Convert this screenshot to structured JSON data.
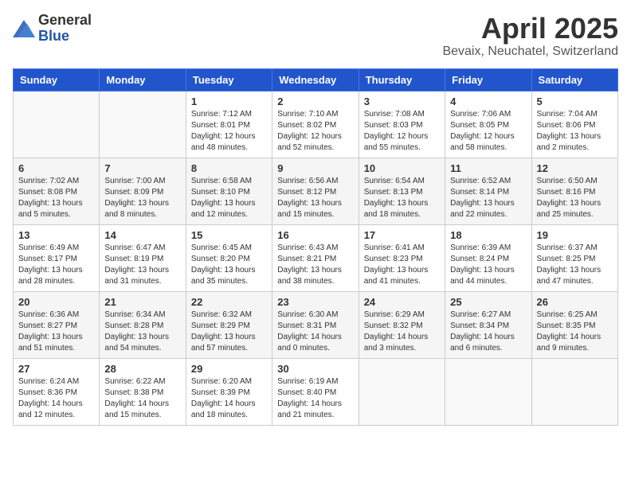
{
  "header": {
    "logo_general": "General",
    "logo_blue": "Blue",
    "month_title": "April 2025",
    "location": "Bevaix, Neuchatel, Switzerland"
  },
  "weekdays": [
    "Sunday",
    "Monday",
    "Tuesday",
    "Wednesday",
    "Thursday",
    "Friday",
    "Saturday"
  ],
  "weeks": [
    [
      {
        "day": "",
        "sunrise": "",
        "sunset": "",
        "daylight": ""
      },
      {
        "day": "",
        "sunrise": "",
        "sunset": "",
        "daylight": ""
      },
      {
        "day": "1",
        "sunrise": "Sunrise: 7:12 AM",
        "sunset": "Sunset: 8:01 PM",
        "daylight": "Daylight: 12 hours and 48 minutes."
      },
      {
        "day": "2",
        "sunrise": "Sunrise: 7:10 AM",
        "sunset": "Sunset: 8:02 PM",
        "daylight": "Daylight: 12 hours and 52 minutes."
      },
      {
        "day": "3",
        "sunrise": "Sunrise: 7:08 AM",
        "sunset": "Sunset: 8:03 PM",
        "daylight": "Daylight: 12 hours and 55 minutes."
      },
      {
        "day": "4",
        "sunrise": "Sunrise: 7:06 AM",
        "sunset": "Sunset: 8:05 PM",
        "daylight": "Daylight: 12 hours and 58 minutes."
      },
      {
        "day": "5",
        "sunrise": "Sunrise: 7:04 AM",
        "sunset": "Sunset: 8:06 PM",
        "daylight": "Daylight: 13 hours and 2 minutes."
      }
    ],
    [
      {
        "day": "6",
        "sunrise": "Sunrise: 7:02 AM",
        "sunset": "Sunset: 8:08 PM",
        "daylight": "Daylight: 13 hours and 5 minutes."
      },
      {
        "day": "7",
        "sunrise": "Sunrise: 7:00 AM",
        "sunset": "Sunset: 8:09 PM",
        "daylight": "Daylight: 13 hours and 8 minutes."
      },
      {
        "day": "8",
        "sunrise": "Sunrise: 6:58 AM",
        "sunset": "Sunset: 8:10 PM",
        "daylight": "Daylight: 13 hours and 12 minutes."
      },
      {
        "day": "9",
        "sunrise": "Sunrise: 6:56 AM",
        "sunset": "Sunset: 8:12 PM",
        "daylight": "Daylight: 13 hours and 15 minutes."
      },
      {
        "day": "10",
        "sunrise": "Sunrise: 6:54 AM",
        "sunset": "Sunset: 8:13 PM",
        "daylight": "Daylight: 13 hours and 18 minutes."
      },
      {
        "day": "11",
        "sunrise": "Sunrise: 6:52 AM",
        "sunset": "Sunset: 8:14 PM",
        "daylight": "Daylight: 13 hours and 22 minutes."
      },
      {
        "day": "12",
        "sunrise": "Sunrise: 6:50 AM",
        "sunset": "Sunset: 8:16 PM",
        "daylight": "Daylight: 13 hours and 25 minutes."
      }
    ],
    [
      {
        "day": "13",
        "sunrise": "Sunrise: 6:49 AM",
        "sunset": "Sunset: 8:17 PM",
        "daylight": "Daylight: 13 hours and 28 minutes."
      },
      {
        "day": "14",
        "sunrise": "Sunrise: 6:47 AM",
        "sunset": "Sunset: 8:19 PM",
        "daylight": "Daylight: 13 hours and 31 minutes."
      },
      {
        "day": "15",
        "sunrise": "Sunrise: 6:45 AM",
        "sunset": "Sunset: 8:20 PM",
        "daylight": "Daylight: 13 hours and 35 minutes."
      },
      {
        "day": "16",
        "sunrise": "Sunrise: 6:43 AM",
        "sunset": "Sunset: 8:21 PM",
        "daylight": "Daylight: 13 hours and 38 minutes."
      },
      {
        "day": "17",
        "sunrise": "Sunrise: 6:41 AM",
        "sunset": "Sunset: 8:23 PM",
        "daylight": "Daylight: 13 hours and 41 minutes."
      },
      {
        "day": "18",
        "sunrise": "Sunrise: 6:39 AM",
        "sunset": "Sunset: 8:24 PM",
        "daylight": "Daylight: 13 hours and 44 minutes."
      },
      {
        "day": "19",
        "sunrise": "Sunrise: 6:37 AM",
        "sunset": "Sunset: 8:25 PM",
        "daylight": "Daylight: 13 hours and 47 minutes."
      }
    ],
    [
      {
        "day": "20",
        "sunrise": "Sunrise: 6:36 AM",
        "sunset": "Sunset: 8:27 PM",
        "daylight": "Daylight: 13 hours and 51 minutes."
      },
      {
        "day": "21",
        "sunrise": "Sunrise: 6:34 AM",
        "sunset": "Sunset: 8:28 PM",
        "daylight": "Daylight: 13 hours and 54 minutes."
      },
      {
        "day": "22",
        "sunrise": "Sunrise: 6:32 AM",
        "sunset": "Sunset: 8:29 PM",
        "daylight": "Daylight: 13 hours and 57 minutes."
      },
      {
        "day": "23",
        "sunrise": "Sunrise: 6:30 AM",
        "sunset": "Sunset: 8:31 PM",
        "daylight": "Daylight: 14 hours and 0 minutes."
      },
      {
        "day": "24",
        "sunrise": "Sunrise: 6:29 AM",
        "sunset": "Sunset: 8:32 PM",
        "daylight": "Daylight: 14 hours and 3 minutes."
      },
      {
        "day": "25",
        "sunrise": "Sunrise: 6:27 AM",
        "sunset": "Sunset: 8:34 PM",
        "daylight": "Daylight: 14 hours and 6 minutes."
      },
      {
        "day": "26",
        "sunrise": "Sunrise: 6:25 AM",
        "sunset": "Sunset: 8:35 PM",
        "daylight": "Daylight: 14 hours and 9 minutes."
      }
    ],
    [
      {
        "day": "27",
        "sunrise": "Sunrise: 6:24 AM",
        "sunset": "Sunset: 8:36 PM",
        "daylight": "Daylight: 14 hours and 12 minutes."
      },
      {
        "day": "28",
        "sunrise": "Sunrise: 6:22 AM",
        "sunset": "Sunset: 8:38 PM",
        "daylight": "Daylight: 14 hours and 15 minutes."
      },
      {
        "day": "29",
        "sunrise": "Sunrise: 6:20 AM",
        "sunset": "Sunset: 8:39 PM",
        "daylight": "Daylight: 14 hours and 18 minutes."
      },
      {
        "day": "30",
        "sunrise": "Sunrise: 6:19 AM",
        "sunset": "Sunset: 8:40 PM",
        "daylight": "Daylight: 14 hours and 21 minutes."
      },
      {
        "day": "",
        "sunrise": "",
        "sunset": "",
        "daylight": ""
      },
      {
        "day": "",
        "sunrise": "",
        "sunset": "",
        "daylight": ""
      },
      {
        "day": "",
        "sunrise": "",
        "sunset": "",
        "daylight": ""
      }
    ]
  ]
}
